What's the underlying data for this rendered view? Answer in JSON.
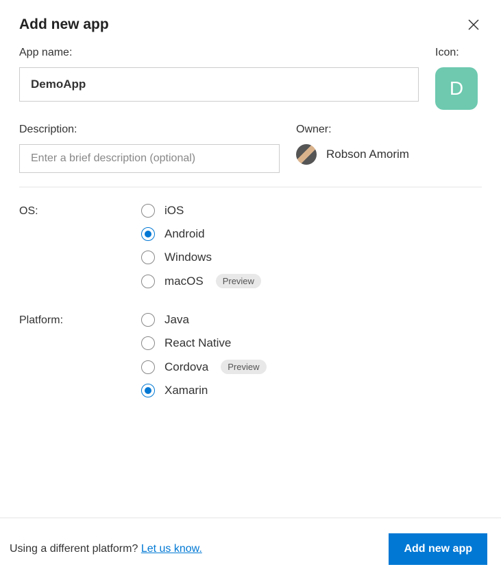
{
  "title": "Add new app",
  "appName": {
    "label": "App name:",
    "value": "DemoApp"
  },
  "icon": {
    "label": "Icon:",
    "letter": "D"
  },
  "description": {
    "label": "Description:",
    "placeholder": "Enter a brief description (optional)"
  },
  "owner": {
    "label": "Owner:",
    "name": "Robson Amorim"
  },
  "os": {
    "label": "OS:",
    "options": [
      {
        "label": "iOS",
        "selected": false,
        "badge": null
      },
      {
        "label": "Android",
        "selected": true,
        "badge": null
      },
      {
        "label": "Windows",
        "selected": false,
        "badge": null
      },
      {
        "label": "macOS",
        "selected": false,
        "badge": "Preview"
      }
    ]
  },
  "platform": {
    "label": "Platform:",
    "options": [
      {
        "label": "Java",
        "selected": false,
        "badge": null
      },
      {
        "label": "React Native",
        "selected": false,
        "badge": null
      },
      {
        "label": "Cordova",
        "selected": false,
        "badge": "Preview"
      },
      {
        "label": "Xamarin",
        "selected": true,
        "badge": null
      }
    ]
  },
  "footer": {
    "text": "Using a different platform? ",
    "link": "Let us know.",
    "button": "Add new app"
  }
}
